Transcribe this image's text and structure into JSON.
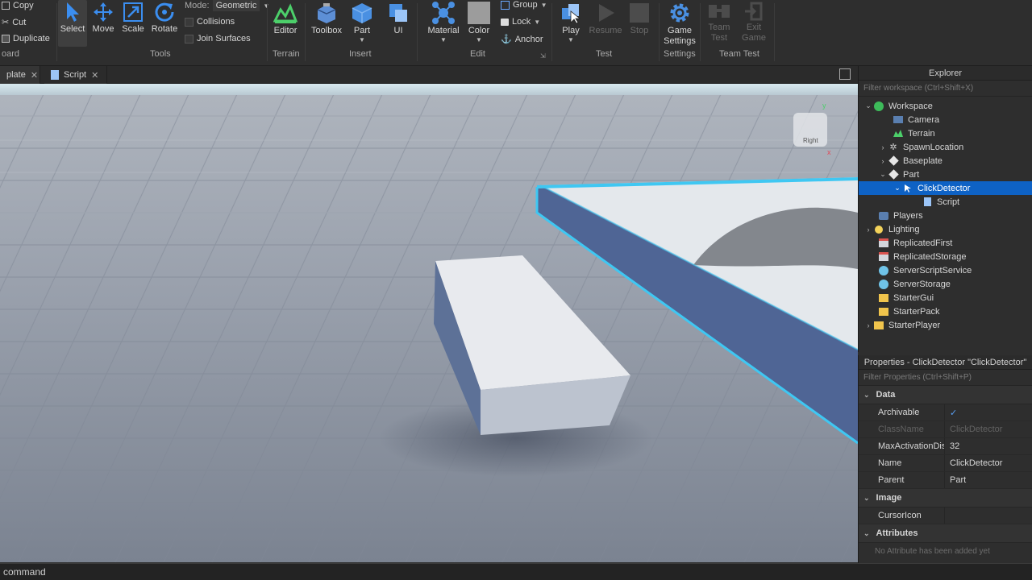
{
  "clipboard": {
    "copy": "Copy",
    "cut": "Cut",
    "duplicate": "Duplicate",
    "group_label": "oard"
  },
  "tools": {
    "select": "Select",
    "move": "Move",
    "scale": "Scale",
    "rotate": "Rotate",
    "mode_label": "Mode:",
    "mode_value": "Geometric",
    "collisions": "Collisions",
    "join_surfaces": "Join Surfaces",
    "group_label": "Tools"
  },
  "terrain": {
    "editor": "Editor",
    "group_label": "Terrain"
  },
  "insert": {
    "toolbox": "Toolbox",
    "part": "Part",
    "ui": "UI",
    "group_label": "Insert"
  },
  "edit": {
    "material": "Material",
    "color": "Color",
    "group": "Group",
    "lock": "Lock",
    "anchor": "Anchor",
    "group_label": "Edit"
  },
  "test": {
    "play": "Play",
    "resume": "Resume",
    "stop": "Stop",
    "group_label": "Test"
  },
  "settings": {
    "game_settings": "Game Settings",
    "group_label": "Settings"
  },
  "team_test": {
    "team_test": "Team Test",
    "exit_game": "Exit Game",
    "group_label": "Team Test"
  },
  "tabs": [
    {
      "label": "plate"
    },
    {
      "label": "Script"
    }
  ],
  "viewcube": {
    "face_label": "Right"
  },
  "command_bar": {
    "text": "command"
  },
  "explorer": {
    "title": "Explorer",
    "filter_placeholder": "Filter workspace (Ctrl+Shift+X)",
    "items": [
      {
        "label": "Workspace",
        "icon": "workspace-icon"
      },
      {
        "label": "Camera",
        "icon": "camera-icon"
      },
      {
        "label": "Terrain",
        "icon": "terrain-icon"
      },
      {
        "label": "SpawnLocation",
        "icon": "spawn-icon"
      },
      {
        "label": "Baseplate",
        "icon": "part-icon"
      },
      {
        "label": "Part",
        "icon": "part-icon"
      },
      {
        "label": "ClickDetector",
        "icon": "clickdetector-icon"
      },
      {
        "label": "Script",
        "icon": "script-icon"
      },
      {
        "label": "Players",
        "icon": "players-icon"
      },
      {
        "label": "Lighting",
        "icon": "lighting-icon"
      },
      {
        "label": "ReplicatedFirst",
        "icon": "replicated-icon"
      },
      {
        "label": "ReplicatedStorage",
        "icon": "replicated-icon"
      },
      {
        "label": "ServerScriptService",
        "icon": "server-icon"
      },
      {
        "label": "ServerStorage",
        "icon": "server-icon"
      },
      {
        "label": "StarterGui",
        "icon": "folder-icon"
      },
      {
        "label": "StarterPack",
        "icon": "folder-icon"
      },
      {
        "label": "StarterPlayer",
        "icon": "folder-icon"
      }
    ]
  },
  "properties": {
    "title": "Properties - ClickDetector \"ClickDetector\"",
    "filter_placeholder": "Filter Properties (Ctrl+Shift+P)",
    "categories": [
      {
        "name": "Data"
      },
      {
        "name": "Image"
      },
      {
        "name": "Attributes"
      }
    ],
    "rows": [
      {
        "key": "Archivable",
        "value": "✓"
      },
      {
        "key": "ClassName",
        "value": "ClickDetector"
      },
      {
        "key": "MaxActivationDista...",
        "value": "32"
      },
      {
        "key": "Name",
        "value": "ClickDetector"
      },
      {
        "key": "Parent",
        "value": "Part"
      },
      {
        "key": "CursorIcon",
        "value": ""
      }
    ],
    "attributes_note": "No Attribute has been added yet"
  },
  "colors": {
    "accent": "#0e62c5",
    "selection_outline": "#3fc7f2",
    "panel": "#2e2e2e"
  }
}
